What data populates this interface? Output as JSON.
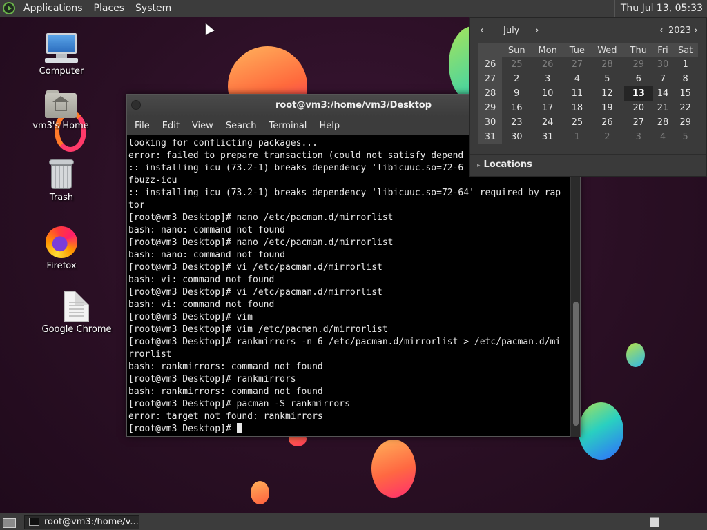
{
  "top_panel": {
    "menus": [
      "Applications",
      "Places",
      "System"
    ],
    "clock": "Thu Jul 13, 05:33"
  },
  "desktop_icons": [
    {
      "label": "Computer",
      "icon": "computer-icon"
    },
    {
      "label": "vm3's Home",
      "icon": "home-folder-icon"
    },
    {
      "label": "Trash",
      "icon": "trash-icon"
    },
    {
      "label": "Firefox",
      "icon": "firefox-icon"
    },
    {
      "label": "Google Chrome",
      "icon": "document-icon"
    }
  ],
  "terminal": {
    "title": "root@vm3:/home/vm3/Desktop",
    "menus": [
      "File",
      "Edit",
      "View",
      "Search",
      "Terminal",
      "Help"
    ],
    "lines": [
      "looking for conflicting packages...",
      "error: failed to prepare transaction (could not satisfy depend",
      ":: installing icu (73.2-1) breaks dependency 'libicuuc.so=72-6",
      "fbuzz-icu",
      ":: installing icu (73.2-1) breaks dependency 'libicuuc.so=72-64' required by rap",
      "tor",
      "[root@vm3 Desktop]# nano /etc/pacman.d/mirrorlist",
      "bash: nano: command not found",
      "[root@vm3 Desktop]# nano /etc/pacman.d/mirrorlist",
      "bash: nano: command not found",
      "[root@vm3 Desktop]# vi /etc/pacman.d/mirrorlist",
      "bash: vi: command not found",
      "[root@vm3 Desktop]# vi /etc/pacman.d/mirrorlist",
      "bash: vi: command not found",
      "[root@vm3 Desktop]# vim",
      "[root@vm3 Desktop]# vim /etc/pacman.d/mirrorlist",
      "[root@vm3 Desktop]# rankmirrors -n 6 /etc/pacman.d/mirrorlist > /etc/pacman.d/mi",
      "rrorlist",
      "bash: rankmirrors: command not found",
      "[root@vm3 Desktop]# rankmirrors",
      "bash: rankmirrors: command not found",
      "[root@vm3 Desktop]# pacman -S rankmirrors",
      "error: target not found: rankmirrors"
    ],
    "prompt": "[root@vm3 Desktop]# "
  },
  "calendar": {
    "month": "July",
    "year": "2023",
    "weekdays": [
      "Sun",
      "Mon",
      "Tue",
      "Wed",
      "Thu",
      "Fri",
      "Sat"
    ],
    "weeks": [
      {
        "week": "26",
        "days": [
          "25",
          "26",
          "27",
          "28",
          "29",
          "30",
          "1"
        ],
        "dim": [
          true,
          true,
          true,
          true,
          true,
          true,
          false
        ]
      },
      {
        "week": "27",
        "days": [
          "2",
          "3",
          "4",
          "5",
          "6",
          "7",
          "8"
        ],
        "dim": [
          false,
          false,
          false,
          false,
          false,
          false,
          false
        ]
      },
      {
        "week": "28",
        "days": [
          "9",
          "10",
          "11",
          "12",
          "13",
          "14",
          "15"
        ],
        "dim": [
          false,
          false,
          false,
          false,
          false,
          false,
          false
        ]
      },
      {
        "week": "29",
        "days": [
          "16",
          "17",
          "18",
          "19",
          "20",
          "21",
          "22"
        ],
        "dim": [
          false,
          false,
          false,
          false,
          false,
          false,
          false
        ]
      },
      {
        "week": "30",
        "days": [
          "23",
          "24",
          "25",
          "26",
          "27",
          "28",
          "29"
        ],
        "dim": [
          false,
          false,
          false,
          false,
          false,
          false,
          false
        ]
      },
      {
        "week": "31",
        "days": [
          "30",
          "31",
          "1",
          "2",
          "3",
          "4",
          "5"
        ],
        "dim": [
          false,
          false,
          true,
          true,
          true,
          true,
          true
        ]
      }
    ],
    "today": "13",
    "locations_label": "Locations"
  },
  "bottom_panel": {
    "task_label": "root@vm3:/home/v..."
  }
}
